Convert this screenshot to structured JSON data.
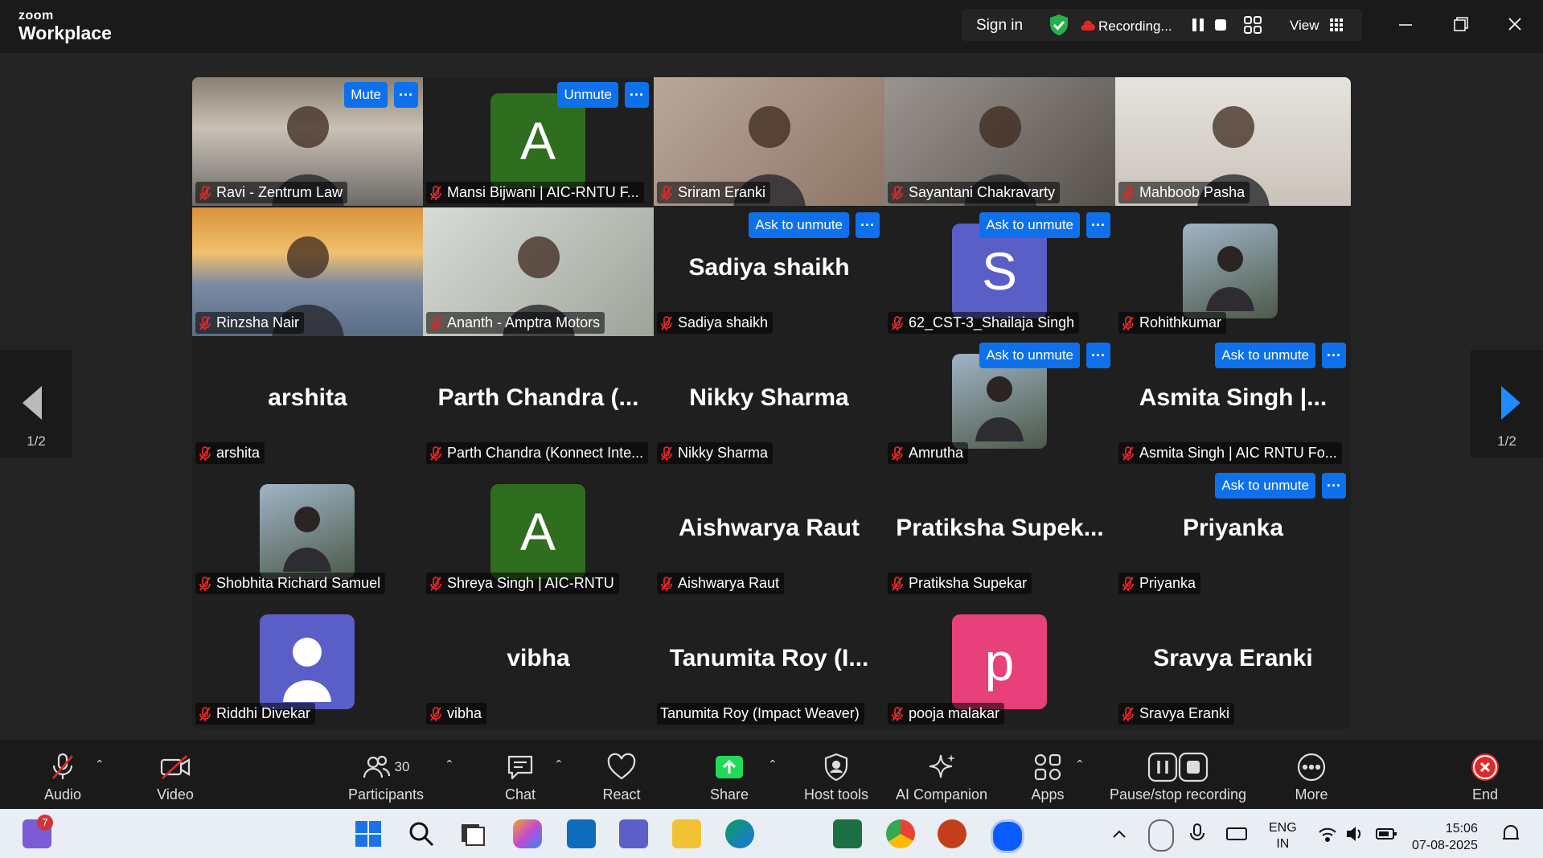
{
  "app": {
    "brand_top": "zoom",
    "brand_bottom": "Workplace"
  },
  "top_controls": {
    "sign_in": "Sign in",
    "recording": "Recording...",
    "view": "View"
  },
  "colors": {
    "accent_blue": "#0e71eb",
    "active_speaker": "#23d959",
    "end_red": "#e02828",
    "muted_red": "#e02828"
  },
  "participants": [
    {
      "name": "Ravi - Zentrum Law",
      "type": "video",
      "active": true,
      "button": "Mute"
    },
    {
      "name": "Mansi Bijwani | AIC-RNTU F...",
      "type": "avatar",
      "letter": "A",
      "color": "#2f6d1f",
      "button": "Unmute"
    },
    {
      "name": "Sriram Eranki",
      "type": "video"
    },
    {
      "name": "Sayantani Chakravarty",
      "type": "video"
    },
    {
      "name": "Mahboob Pasha",
      "type": "video"
    },
    {
      "name": "Rinzsha Nair",
      "type": "video"
    },
    {
      "name": "Ananth - Amptra Motors",
      "type": "video"
    },
    {
      "name": "Sadiya shaikh",
      "type": "text",
      "big": "Sadiya shaikh",
      "button": "Ask to unmute"
    },
    {
      "name": "62_CST-3_Shailaja Singh",
      "type": "avatar",
      "letter": "S",
      "color": "#5a5fc8",
      "button": "Ask to unmute"
    },
    {
      "name": "Rohithkumar",
      "type": "photo"
    },
    {
      "name": "arshita",
      "type": "text",
      "big": "arshita"
    },
    {
      "name": "Parth Chandra (Konnect Inte...",
      "type": "text",
      "big": "Parth Chandra (..."
    },
    {
      "name": "Nikky Sharma",
      "type": "text",
      "big": "Nikky Sharma"
    },
    {
      "name": "Amrutha",
      "type": "photo",
      "button": "Ask to unmute"
    },
    {
      "name": "Asmita Singh | AIC RNTU Fo...",
      "type": "text",
      "big": "Asmita Singh |...",
      "button": "Ask to unmute"
    },
    {
      "name": "Shobhita Richard Samuel",
      "type": "photo"
    },
    {
      "name": "Shreya Singh | AIC-RNTU",
      "type": "avatar",
      "letter": "A",
      "color": "#2f6d1f"
    },
    {
      "name": "Aishwarya Raut",
      "type": "text",
      "big": "Aishwarya Raut"
    },
    {
      "name": "Pratiksha Supekar",
      "type": "text",
      "big": "Pratiksha Supek..."
    },
    {
      "name": "Priyanka",
      "type": "text",
      "big": "Priyanka",
      "button": "Ask to unmute"
    },
    {
      "name": "Riddhi Divekar",
      "type": "person",
      "color": "#5a5fc8"
    },
    {
      "name": "vibha",
      "type": "text",
      "big": "vibha"
    },
    {
      "name": "Tanumita Roy (Impact Weaver)",
      "type": "text",
      "big": "Tanumita Roy (I...",
      "nomic": true
    },
    {
      "name": "pooja malakar",
      "type": "avatar",
      "letter": "p",
      "color": "#e8407a"
    },
    {
      "name": "Sravya Eranki",
      "type": "text",
      "big": "Sravya Eranki"
    }
  ],
  "pagination": {
    "left": "1/2",
    "right": "1/2"
  },
  "toolbar": {
    "audio": "Audio",
    "video": "Video",
    "participants": "Participants",
    "participants_count": "30",
    "chat": "Chat",
    "react": "React",
    "share": "Share",
    "host_tools": "Host tools",
    "ai_companion": "AI Companion",
    "apps": "Apps",
    "pause_stop": "Pause/stop recording",
    "more": "More",
    "end": "End"
  },
  "taskbar": {
    "lang1": "ENG",
    "lang2": "IN",
    "time": "15:06",
    "date": "07-08-2025",
    "teams_badge": "7"
  }
}
